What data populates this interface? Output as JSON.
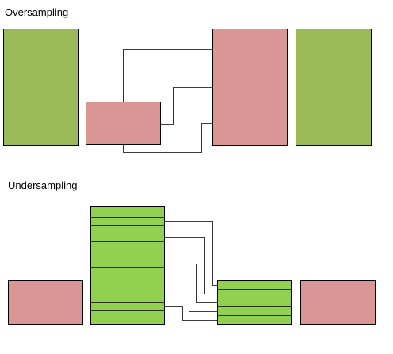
{
  "sections": {
    "oversampling_title": "Oversampling",
    "undersampling_title": "Undersampling"
  },
  "colors": {
    "majority_green": "#9bbb59",
    "minority_pink": "#d99694",
    "sample_green": "#92d050"
  }
}
